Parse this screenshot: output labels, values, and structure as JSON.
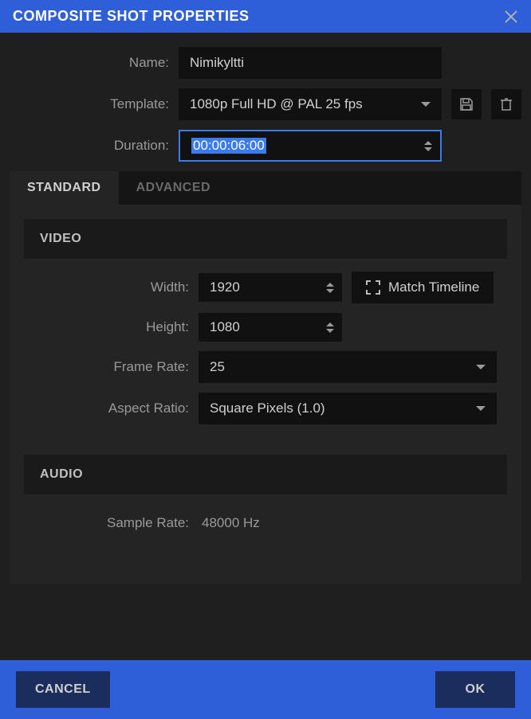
{
  "title": "COMPOSITE SHOT PROPERTIES",
  "form": {
    "name_label": "Name:",
    "name_value": "Nimikyltti",
    "template_label": "Template:",
    "template_value": "1080p Full HD @ PAL 25 fps",
    "duration_label": "Duration:",
    "duration_value": "00:00:06:00"
  },
  "tabs": {
    "standard": "STANDARD",
    "advanced": "ADVANCED"
  },
  "video": {
    "header": "VIDEO",
    "width_label": "Width:",
    "width_value": "1920",
    "height_label": "Height:",
    "height_value": "1080",
    "framerate_label": "Frame Rate:",
    "framerate_value": "25",
    "aspect_label": "Aspect Ratio:",
    "aspect_value": "Square Pixels (1.0)",
    "match_timeline": "Match Timeline"
  },
  "audio": {
    "header": "AUDIO",
    "samplerate_label": "Sample Rate:",
    "samplerate_value": "48000 Hz"
  },
  "buttons": {
    "cancel": "CANCEL",
    "ok": "OK"
  }
}
